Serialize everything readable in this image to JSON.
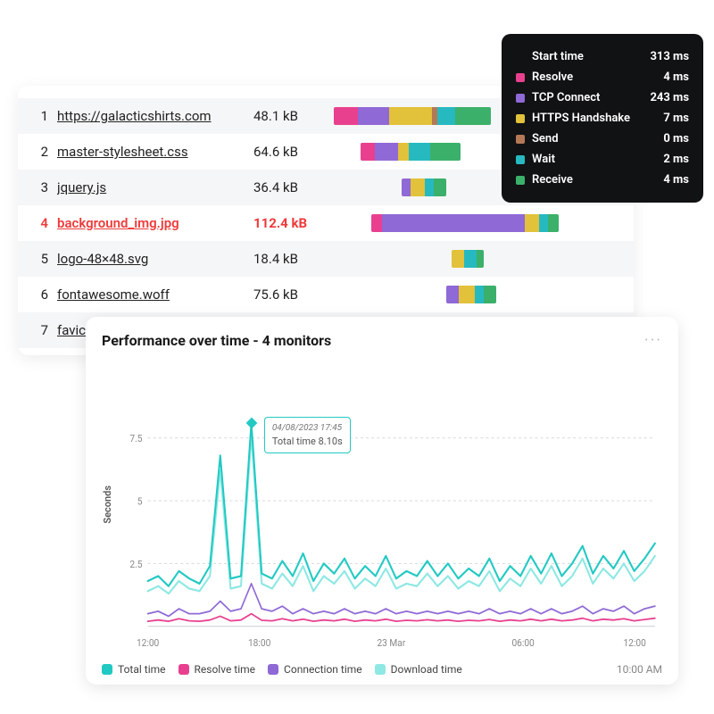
{
  "waterfall": {
    "rows": [
      {
        "idx": "1",
        "name": "https://galacticshirts.com",
        "size": "48.1 kB",
        "highlight": false
      },
      {
        "idx": "2",
        "name": "master-stylesheet.css",
        "size": "64.6 kB",
        "highlight": false
      },
      {
        "idx": "3",
        "name": "jquery.js",
        "size": "36.4 kB",
        "highlight": false
      },
      {
        "idx": "4",
        "name": "background_img.jpg",
        "size": "112.4 kB",
        "highlight": true
      },
      {
        "idx": "5",
        "name": "logo-48×48.svg",
        "size": "18.4 kB",
        "highlight": false
      },
      {
        "idx": "6",
        "name": "fontawesome.woff",
        "size": "75.6 kB",
        "highlight": false
      },
      {
        "idx": "7",
        "name": "favic",
        "size": "",
        "highlight": false
      }
    ],
    "bars": [
      {
        "offset": 0,
        "segs": [
          {
            "c": "c-resolve",
            "w": 27
          },
          {
            "c": "c-tcp",
            "w": 35
          },
          {
            "c": "c-https",
            "w": 48
          },
          {
            "c": "c-send",
            "w": 6
          },
          {
            "c": "c-wait",
            "w": 20
          },
          {
            "c": "c-receive",
            "w": 40
          }
        ]
      },
      {
        "offset": 30,
        "segs": [
          {
            "c": "c-resolve",
            "w": 16
          },
          {
            "c": "c-tcp",
            "w": 26
          },
          {
            "c": "c-https",
            "w": 12
          },
          {
            "c": "c-wait",
            "w": 24
          },
          {
            "c": "c-receive",
            "w": 34
          }
        ]
      },
      {
        "offset": 76,
        "segs": [
          {
            "c": "c-tcp",
            "w": 10
          },
          {
            "c": "c-https",
            "w": 16
          },
          {
            "c": "c-wait",
            "w": 10
          },
          {
            "c": "c-receive",
            "w": 14
          }
        ]
      },
      {
        "offset": 42,
        "segs": [
          {
            "c": "c-resolve",
            "w": 12
          },
          {
            "c": "c-tcp",
            "w": 160
          },
          {
            "c": "c-https",
            "w": 16
          },
          {
            "c": "c-wait",
            "w": 10
          },
          {
            "c": "c-receive",
            "w": 12
          }
        ]
      },
      {
        "offset": 132,
        "segs": [
          {
            "c": "c-https",
            "w": 14
          },
          {
            "c": "c-wait",
            "w": 14
          },
          {
            "c": "c-receive",
            "w": 8
          }
        ]
      },
      {
        "offset": 126,
        "segs": [
          {
            "c": "c-tcp",
            "w": 14
          },
          {
            "c": "c-https",
            "w": 18
          },
          {
            "c": "c-wait",
            "w": 10
          },
          {
            "c": "c-receive",
            "w": 14
          }
        ]
      },
      {
        "offset": 0,
        "segs": []
      }
    ]
  },
  "tooltip": {
    "rows": [
      {
        "swatch": null,
        "label": "Start time",
        "value": "313 ms"
      },
      {
        "swatch": "#e8408f",
        "label": "Resolve",
        "value": "4 ms"
      },
      {
        "swatch": "#8f69d6",
        "label": "TCP Connect",
        "value": "243 ms"
      },
      {
        "swatch": "#e2c13b",
        "label": "HTTPS Handshake",
        "value": "7 ms"
      },
      {
        "swatch": "#b37956",
        "label": "Send",
        "value": "0 ms"
      },
      {
        "swatch": "#27b9c0",
        "label": "Wait",
        "value": "2 ms"
      },
      {
        "swatch": "#3bb06a",
        "label": "Receive",
        "value": "4 ms"
      }
    ]
  },
  "perf": {
    "title": "Performance over time - 4 monitors",
    "ylabel": "Seconds",
    "timestamp": "10:00 AM",
    "legend": [
      {
        "label": "Total time",
        "color": "#22c9c3"
      },
      {
        "label": "Resolve time",
        "color": "#e8408f"
      },
      {
        "label": "Connection time",
        "color": "#8f69d6"
      },
      {
        "label": "Download time",
        "color": "#8ee8e3"
      }
    ],
    "hover": {
      "date": "04/08/2023 17:45",
      "text": "Total time 8.10s"
    }
  },
  "chart_data": {
    "type": "line",
    "title": "Performance over time - 4 monitors",
    "xlabel": "",
    "ylabel": "Seconds",
    "ylim": [
      0,
      10
    ],
    "yticks": [
      2.5,
      5,
      7.5
    ],
    "xticks": [
      "12:00",
      "18:00",
      "23 Mar",
      "06:00",
      "12:00"
    ],
    "x": [
      0,
      1,
      2,
      3,
      4,
      5,
      6,
      7,
      8,
      9,
      10,
      11,
      12,
      13,
      14,
      15,
      16,
      17,
      18,
      19,
      20,
      21,
      22,
      23,
      24,
      25,
      26,
      27,
      28,
      29,
      30,
      31,
      32,
      33,
      34,
      35,
      36,
      37,
      38,
      39,
      40,
      41,
      42,
      43,
      44,
      45,
      46,
      47,
      48,
      49
    ],
    "series": [
      {
        "name": "Total time",
        "color": "#22c9c3",
        "values": [
          1.8,
          2.0,
          1.6,
          2.2,
          1.9,
          1.7,
          2.4,
          6.8,
          1.9,
          2.0,
          8.1,
          2.1,
          1.9,
          2.6,
          2.0,
          2.9,
          1.8,
          2.5,
          2.1,
          2.7,
          1.9,
          2.4,
          2.0,
          2.8,
          1.9,
          2.2,
          2.0,
          2.6,
          2.0,
          2.5,
          1.9,
          2.3,
          2.0,
          2.7,
          1.8,
          2.4,
          2.0,
          2.8,
          2.1,
          2.9,
          2.0,
          2.5,
          3.2,
          2.1,
          2.8,
          2.3,
          3.0,
          2.2,
          2.7,
          3.3
        ]
      },
      {
        "name": "Download time",
        "color": "#8ee8e3",
        "values": [
          1.4,
          1.6,
          1.3,
          1.8,
          1.5,
          1.4,
          2.0,
          6.2,
          1.5,
          1.6,
          7.6,
          1.7,
          1.5,
          2.1,
          1.6,
          2.4,
          1.4,
          2.0,
          1.7,
          2.2,
          1.5,
          1.9,
          1.6,
          2.3,
          1.5,
          1.7,
          1.6,
          2.1,
          1.6,
          2.0,
          1.5,
          1.8,
          1.6,
          2.2,
          1.4,
          1.9,
          1.6,
          2.3,
          1.7,
          2.4,
          1.6,
          2.0,
          2.7,
          1.7,
          2.3,
          1.9,
          2.5,
          1.8,
          2.2,
          2.8
        ]
      },
      {
        "name": "Connection time",
        "color": "#8f69d6",
        "values": [
          0.5,
          0.6,
          0.4,
          0.7,
          0.5,
          0.5,
          0.6,
          1.0,
          0.6,
          0.7,
          1.7,
          0.7,
          0.6,
          0.8,
          0.5,
          0.7,
          0.5,
          0.6,
          0.5,
          0.7,
          0.5,
          0.6,
          0.5,
          0.7,
          0.5,
          0.6,
          0.5,
          0.6,
          0.5,
          0.6,
          0.5,
          0.6,
          0.5,
          0.7,
          0.5,
          0.6,
          0.5,
          0.7,
          0.5,
          0.7,
          0.5,
          0.6,
          0.8,
          0.5,
          0.7,
          0.6,
          0.8,
          0.5,
          0.7,
          0.8
        ]
      },
      {
        "name": "Resolve time",
        "color": "#e8408f",
        "values": [
          0.2,
          0.25,
          0.2,
          0.3,
          0.22,
          0.2,
          0.25,
          0.4,
          0.22,
          0.25,
          0.5,
          0.24,
          0.22,
          0.3,
          0.22,
          0.28,
          0.2,
          0.25,
          0.22,
          0.28,
          0.2,
          0.25,
          0.22,
          0.28,
          0.2,
          0.24,
          0.22,
          0.26,
          0.22,
          0.25,
          0.2,
          0.24,
          0.22,
          0.27,
          0.2,
          0.25,
          0.22,
          0.28,
          0.22,
          0.28,
          0.22,
          0.25,
          0.32,
          0.22,
          0.28,
          0.25,
          0.3,
          0.22,
          0.27,
          0.32
        ]
      }
    ],
    "annotation": {
      "x": 10,
      "date": "04/08/2023 17:45",
      "text": "Total time 8.10s"
    }
  }
}
